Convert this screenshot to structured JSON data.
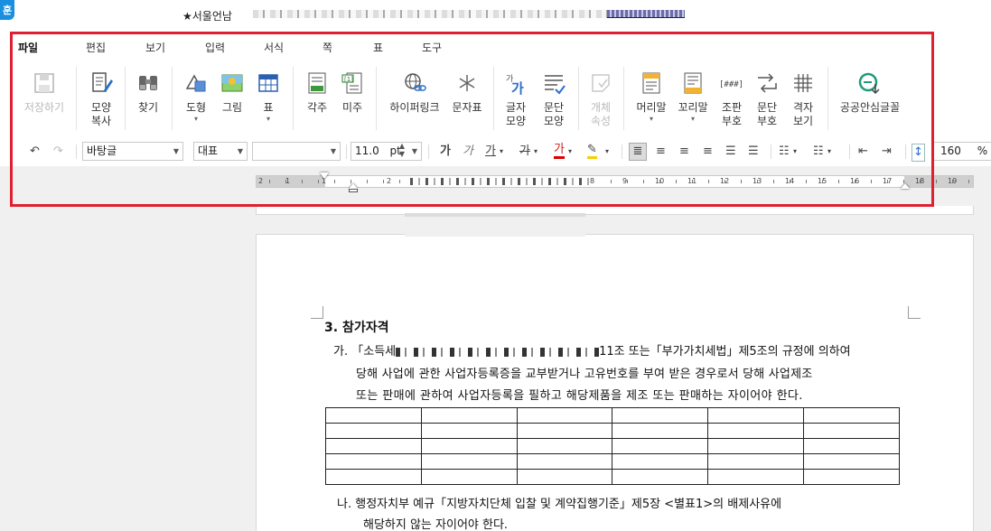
{
  "title_bar": {
    "app_badge": "훈",
    "document_title": "★서울언남ᅟ"
  },
  "menu": {
    "items": [
      "파일",
      "편집",
      "보기",
      "입력",
      "서식",
      "쪽",
      "표",
      "도구"
    ]
  },
  "ribbon": {
    "save": "저장하기",
    "shape_copy": "모양\n복사",
    "find": "찾기",
    "shape": "도형",
    "picture": "그림",
    "table": "표",
    "footnote": "각주",
    "endnote": "미주",
    "hyperlink": "하이퍼링크",
    "char_table": "문자표",
    "char_shape": "글자\n모양",
    "para_shape": "문단\n모양",
    "object_props": "개체\n속성",
    "header": "머리말",
    "footer": "꼬리말",
    "page_numbering": "조판\n부호",
    "para_marks": "문단\n부호",
    "grid_view": "격자\n보기",
    "safe_font": "공공안심글꼴"
  },
  "format_bar": {
    "style": "바탕글",
    "font_lang": "대표",
    "font_name": "",
    "font_size": "11.0",
    "font_unit": "pt",
    "bold": "가",
    "italic": "가",
    "underline": "가",
    "strike": "가",
    "font_color": "가",
    "line_spacing": "160",
    "line_spacing_unit": "%"
  },
  "ruler": {
    "numbers": [
      "2",
      "1",
      "1",
      "2",
      "8",
      "9",
      "10",
      "11",
      "12",
      "13",
      "14",
      "15",
      "16",
      "17",
      "18",
      "19"
    ]
  },
  "document": {
    "section_title": "3. 참가자격",
    "para_a": {
      "marker": "가.",
      "line1_start": "「소득세",
      "line1_end": "11조 또는「부가가치세법」제5조의 규정에 의하여",
      "line2": "당해 사업에 관한 사업자등록증을 교부받거나 고유번호를 부여 받은 경우로서 당해 사업제조",
      "line3": "또는 판매에 관하여 사업자등록을 필하고 해당제품을 제조 또는 판매하는 자이어야 한다."
    },
    "table": {
      "rows": 5,
      "cols": 6
    },
    "para_b": {
      "marker": "나.",
      "line1": "행정자치부 예규「지방자치단체 입찰 및 계약집행기준」제5장 <별표1>의 배제사유에",
      "line2": "해당하지 않는 자이어야 한다."
    }
  },
  "colors": {
    "highlight_frame": "#e02030",
    "app_badge": "#1a8fe0"
  }
}
